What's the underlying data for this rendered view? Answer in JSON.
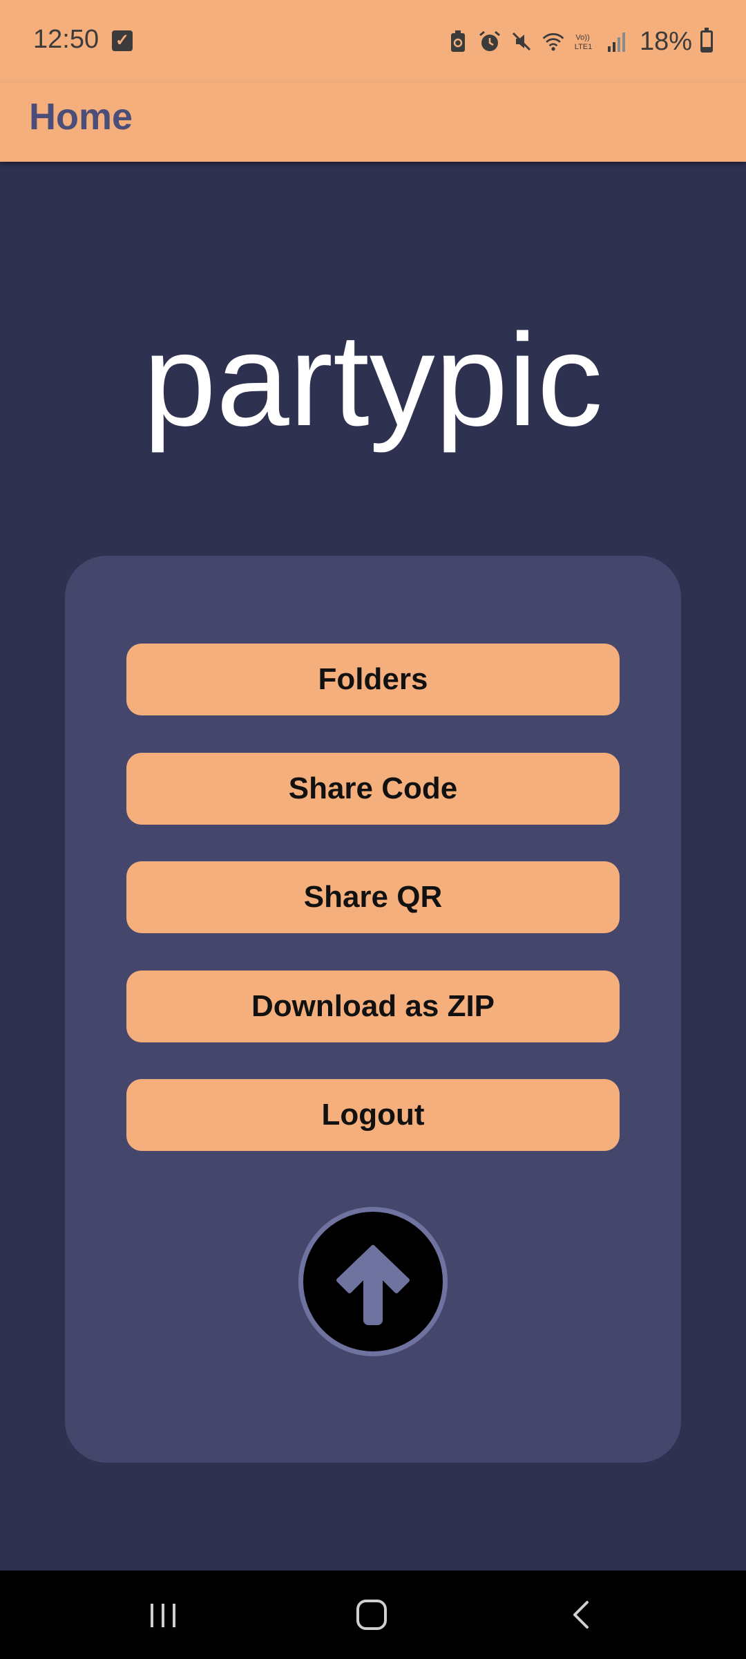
{
  "status_bar": {
    "time": "12:50",
    "battery_percent": "18%",
    "battery_level": 0.18,
    "icons": [
      "check-box-icon",
      "battery-saver-icon",
      "alarm-icon",
      "mute-icon",
      "wifi-icon",
      "volte-lte-icon",
      "signal-icon",
      "battery-icon"
    ]
  },
  "app_bar": {
    "title": "Home"
  },
  "brand": {
    "name": "partypic"
  },
  "menu": {
    "folders": "Folders",
    "share_code": "Share Code",
    "share_qr": "Share QR",
    "download_zip": "Download as ZIP",
    "logout": "Logout"
  },
  "upload": {
    "icon": "arrow-up-icon"
  },
  "nav_bar": {
    "icons": [
      "recent-apps-icon",
      "home-icon",
      "back-icon"
    ]
  },
  "colors": {
    "accent": "#f5af7d",
    "background": "#2e3150",
    "card": "#44476b",
    "title_text": "#4a4e78",
    "upload_ring": "#6f739f"
  }
}
